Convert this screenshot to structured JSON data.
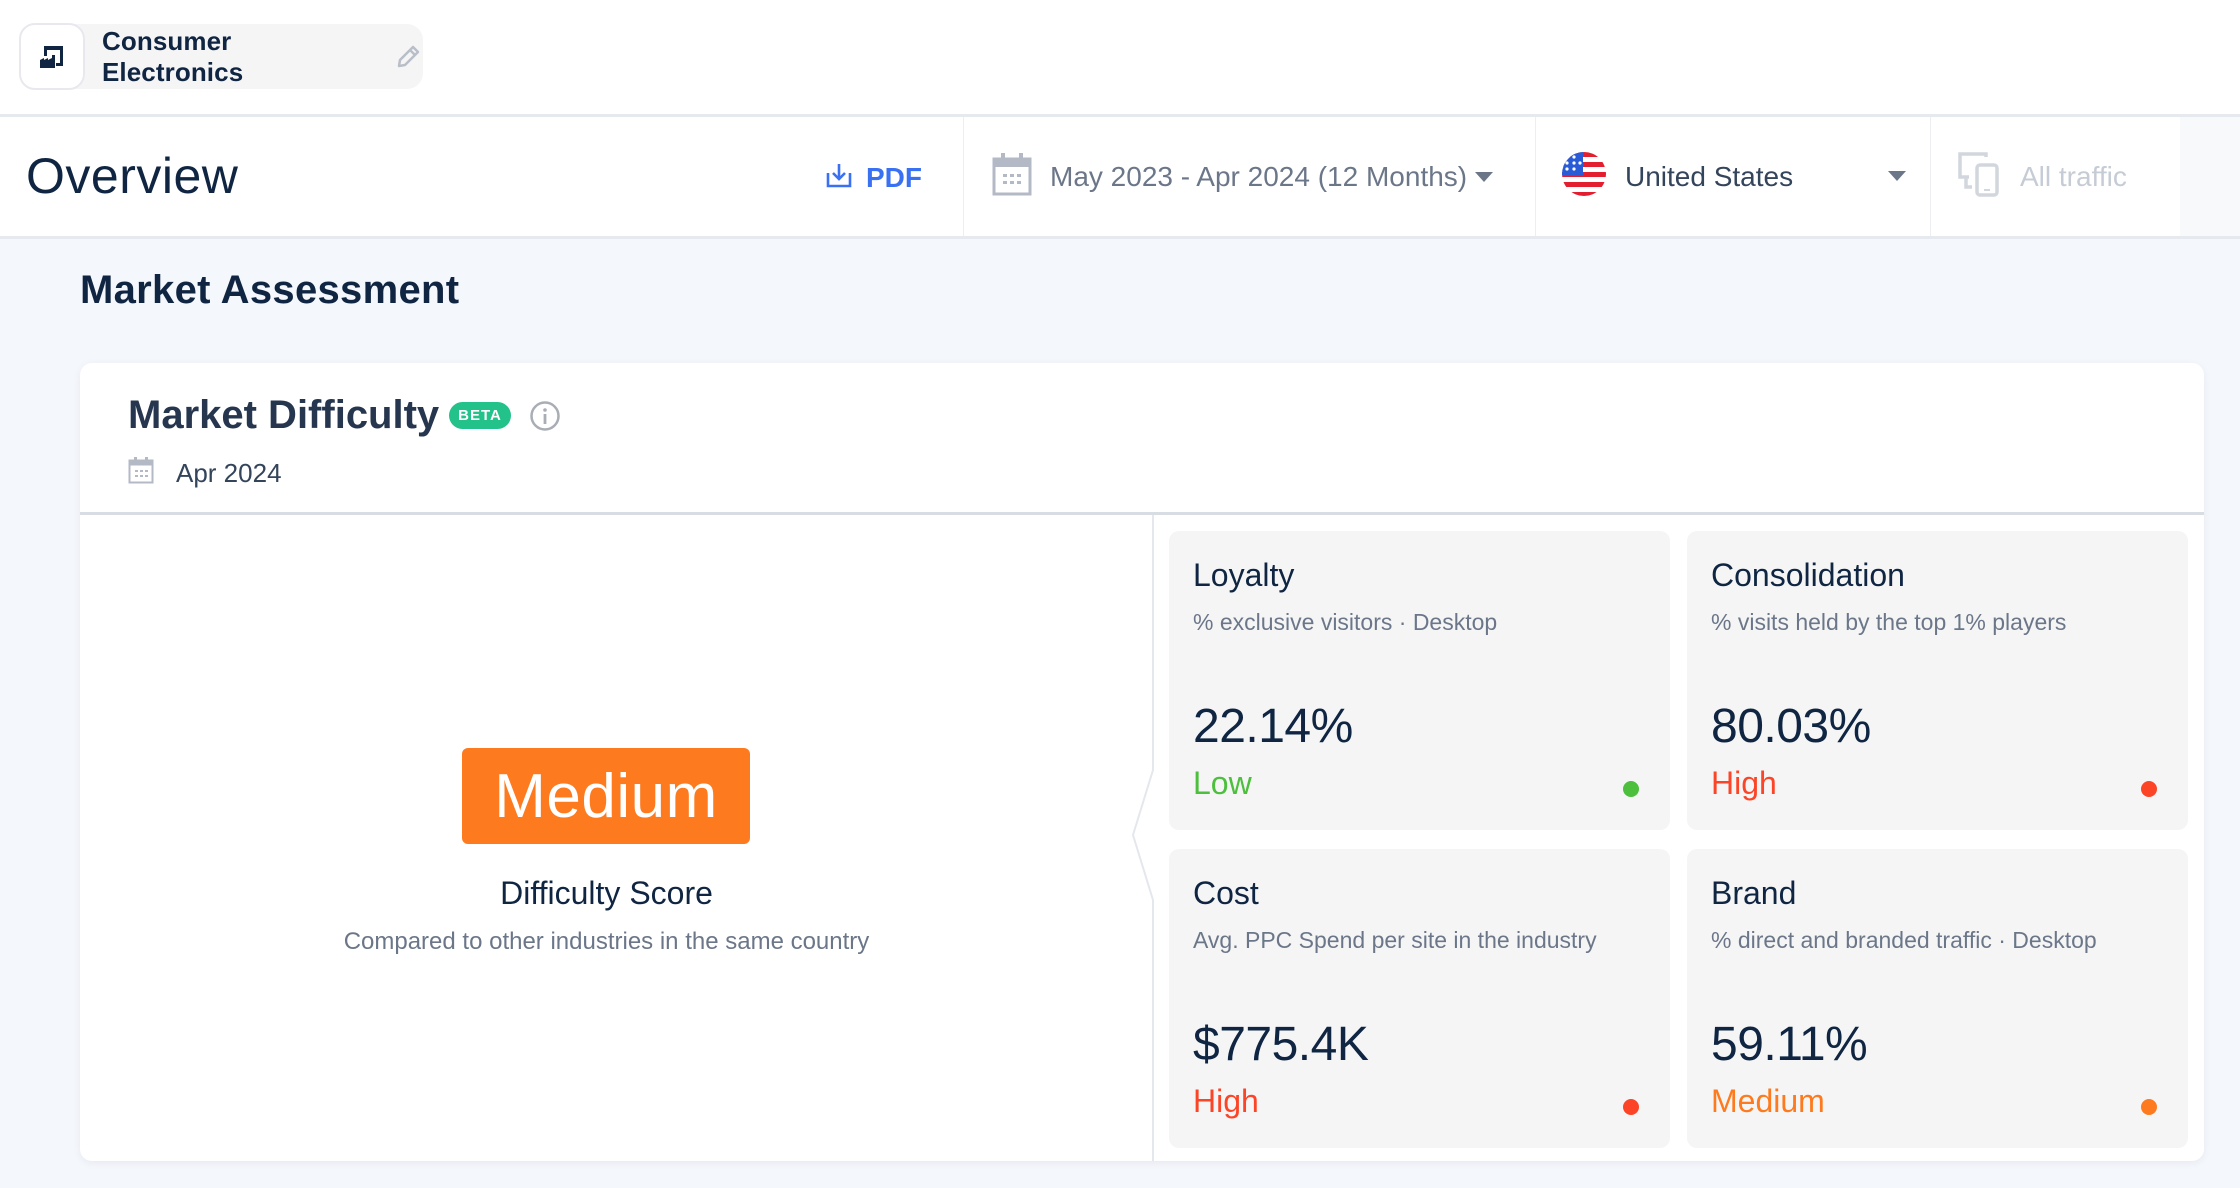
{
  "topbar": {
    "industry_icon": "industry-factory-icon",
    "industry_label": "Consumer Electronics",
    "edit_icon": "pencil-icon"
  },
  "header": {
    "title": "Overview",
    "pdf_label": "PDF",
    "pdf_icon": "download-icon",
    "date_range": "May 2023 - Apr 2024 (12 Months)",
    "date_icon": "calendar-icon",
    "country": "United States",
    "country_flag": "us-flag-icon",
    "traffic": "All traffic",
    "traffic_icon": "devices-icon"
  },
  "section": {
    "title": "Market Assessment"
  },
  "card": {
    "title": "Market Difficulty",
    "badge": "BETA",
    "date": "Apr 2024",
    "score": {
      "level": "Medium",
      "level_color": "#fd7b1e",
      "title": "Difficulty Score",
      "subtitle": "Compared to other industries in the same country"
    },
    "metrics": [
      {
        "title": "Loyalty",
        "subtitle": "% exclusive visitors · Desktop",
        "value": "22.14%",
        "level": "Low",
        "color": "#4cbf3c"
      },
      {
        "title": "Consolidation",
        "subtitle": "% visits held by the top 1% players",
        "value": "80.03%",
        "level": "High",
        "color": "#fc4526"
      },
      {
        "title": "Cost",
        "subtitle": "Avg. PPC Spend per site in the industry",
        "value": "$775.4K",
        "level": "High",
        "color": "#fc4526"
      },
      {
        "title": "Brand",
        "subtitle": "% direct and branded traffic · Desktop",
        "value": "59.11%",
        "level": "Medium",
        "color": "#fd7b1e"
      }
    ]
  }
}
